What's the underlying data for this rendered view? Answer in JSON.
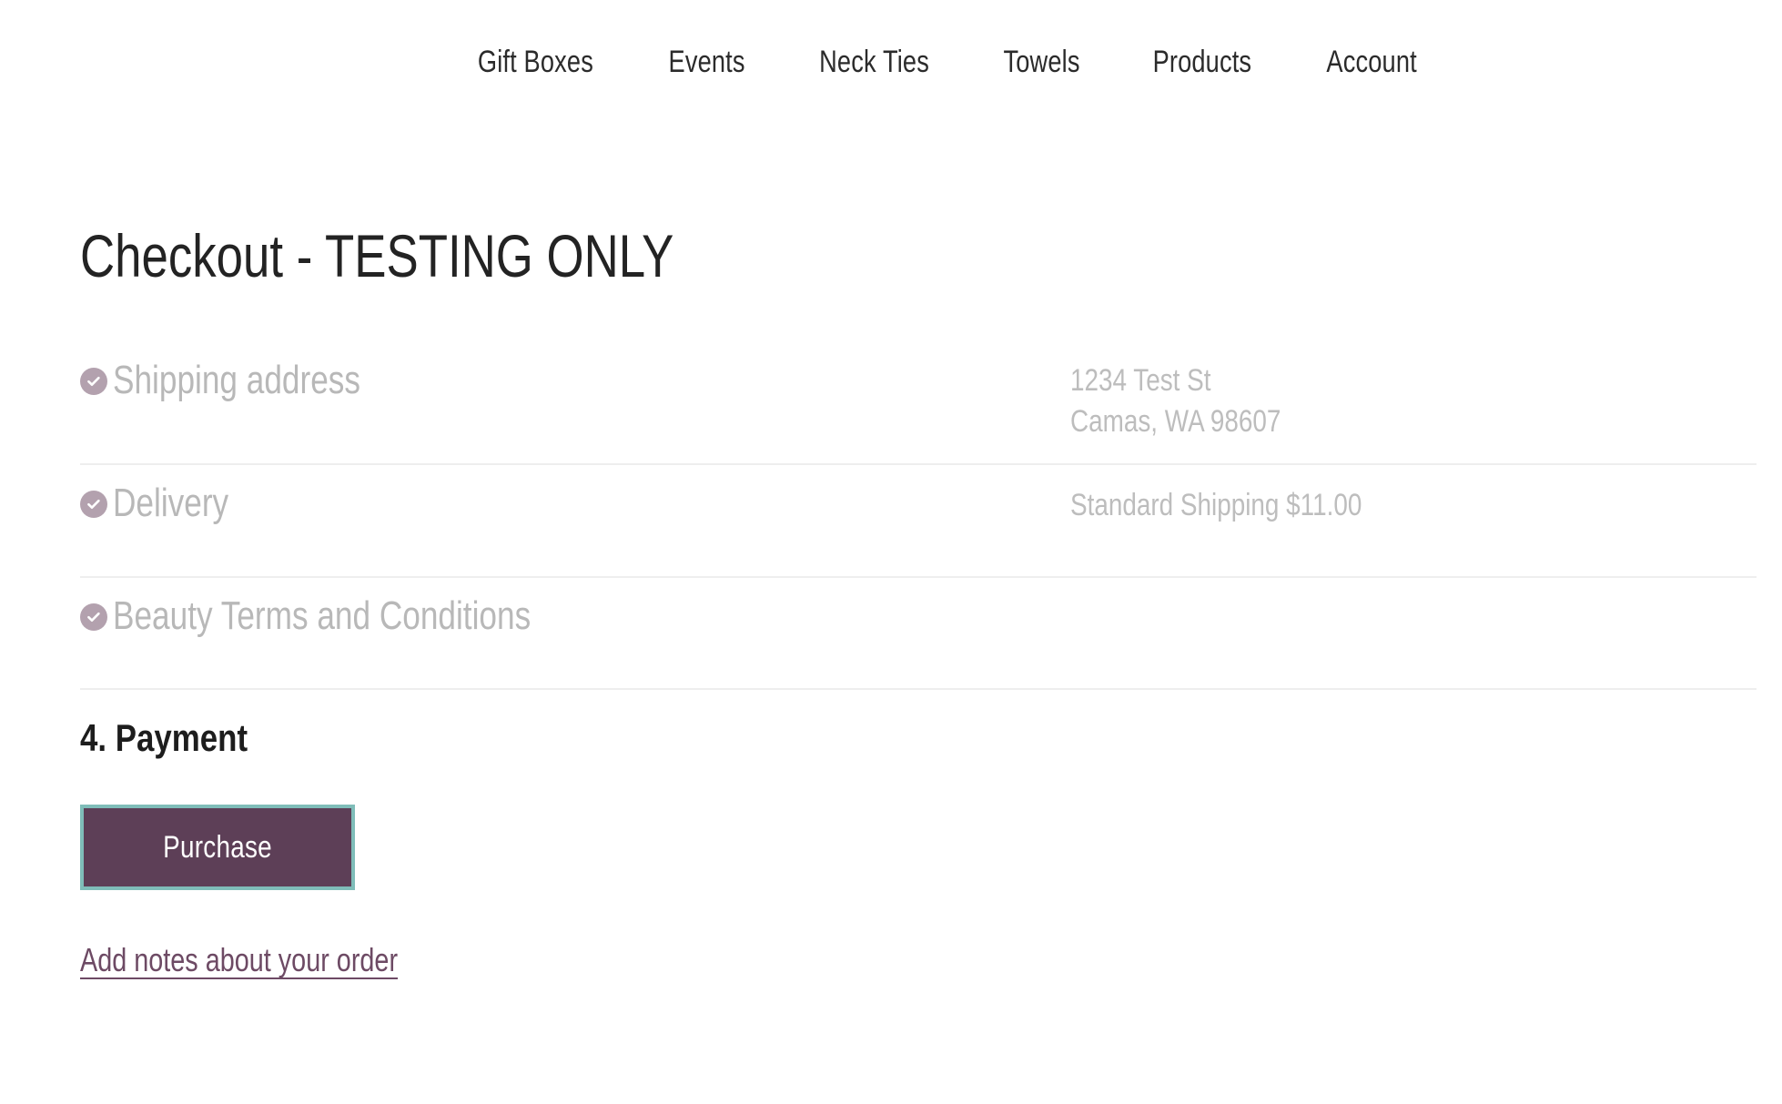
{
  "nav": {
    "items": [
      {
        "label": "Gift Boxes",
        "name": "nav-item-gift-boxes"
      },
      {
        "label": "Events",
        "name": "nav-item-events"
      },
      {
        "label": "Neck Ties",
        "name": "nav-item-neck-ties"
      },
      {
        "label": "Towels",
        "name": "nav-item-towels"
      },
      {
        "label": "Products",
        "name": "nav-item-products"
      },
      {
        "label": "Account",
        "name": "nav-item-account"
      }
    ]
  },
  "page": {
    "title": "Checkout - TESTING ONLY"
  },
  "steps": [
    {
      "label": "Shipping address",
      "completed": true,
      "summary_lines": [
        "1234 Test St",
        "Camas, WA 98607"
      ]
    },
    {
      "label": "Delivery",
      "completed": true,
      "summary_lines": [
        "Standard Shipping $11.00"
      ]
    },
    {
      "label": "Beauty Terms and Conditions",
      "completed": true,
      "summary_lines": []
    }
  ],
  "payment": {
    "heading": "4. Payment",
    "purchase_label": "Purchase",
    "notes_link_label": "Add notes about your order"
  },
  "colors": {
    "check_circle": "#b3a1ae",
    "button_background": "#5d3f57",
    "button_focus_ring": "#7fbdb9",
    "link": "#6d4a64",
    "completed_label": "#b8b8b8",
    "summary_text": "#bdbdbd",
    "divider": "#eeeeee",
    "heading_text": "#1d1d1d",
    "page_background": "#ffffff"
  }
}
